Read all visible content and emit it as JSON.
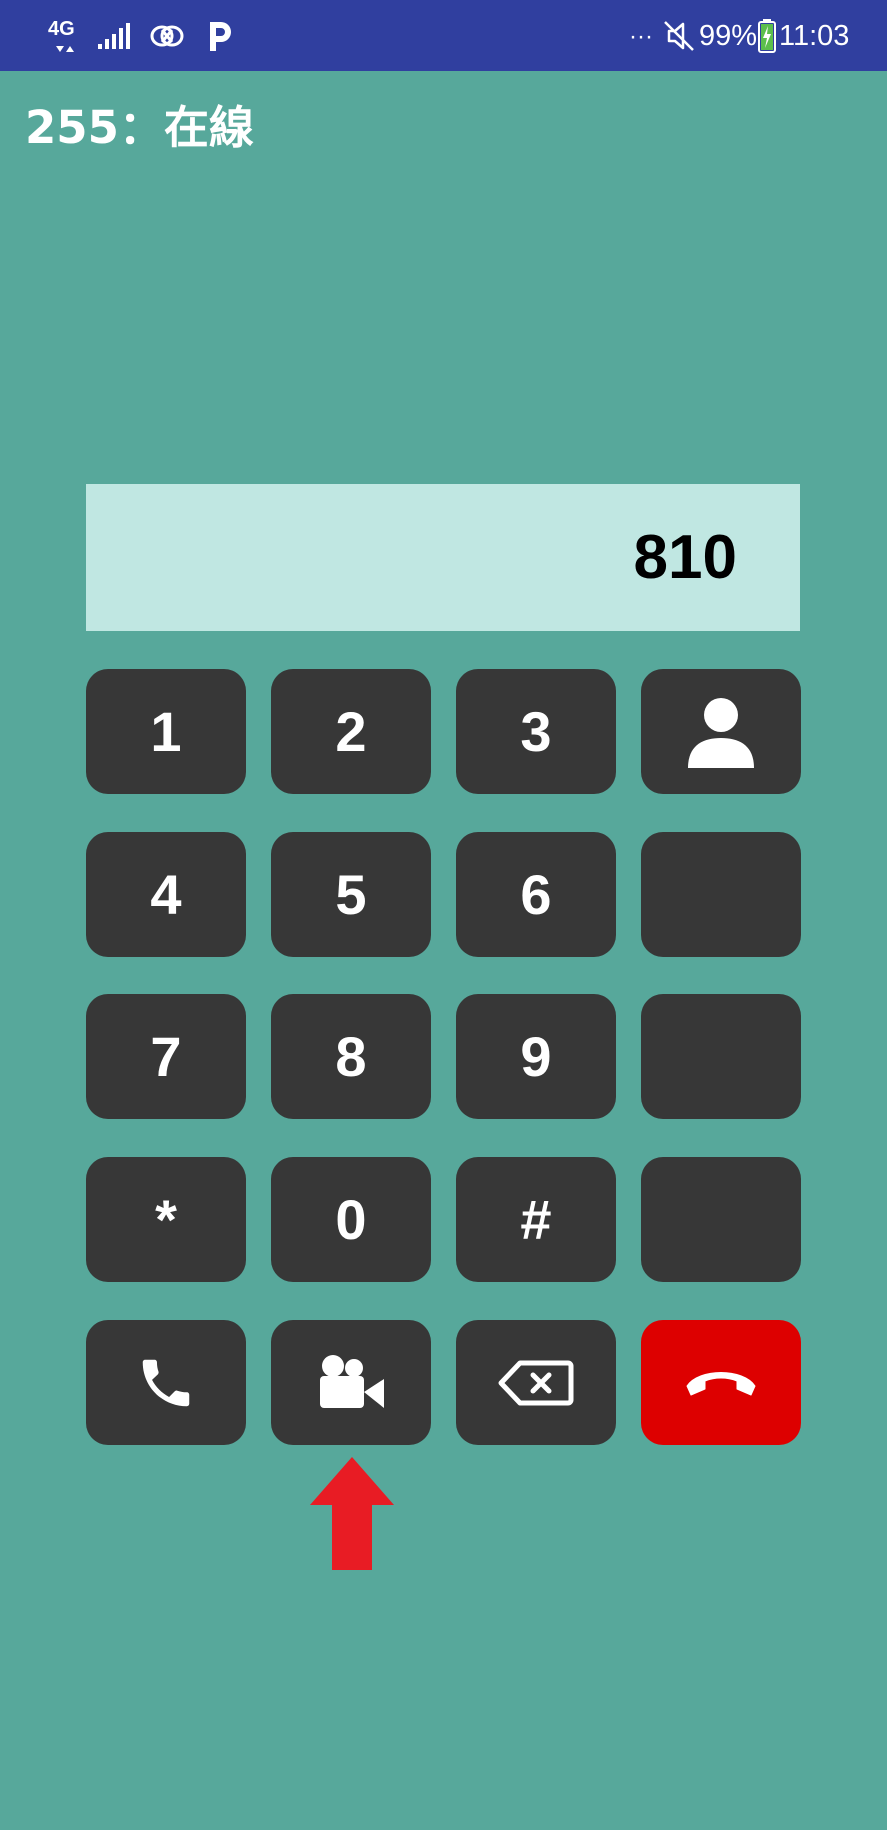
{
  "status_bar": {
    "network_type": "4G",
    "battery": "99%",
    "time": "11:03",
    "overflow": "···",
    "icons": [
      "network-4g-icon",
      "signal-strength-icon",
      "sync-icon",
      "parking-app-icon",
      "mute-icon",
      "battery-charging-icon"
    ]
  },
  "app": {
    "title": "255：在線"
  },
  "dialer": {
    "display_value": "810",
    "keys_row1": [
      "1",
      "2",
      "3"
    ],
    "keys_row2": [
      "4",
      "5",
      "6"
    ],
    "keys_row3": [
      "7",
      "8",
      "9"
    ],
    "keys_row4": [
      "*",
      "0",
      "#"
    ],
    "icons": {
      "contact": "person-icon",
      "call": "phone-icon",
      "video": "video-camera-icon",
      "backspace": "backspace-icon",
      "hangup": "hang-up-icon"
    }
  },
  "colors": {
    "background": "#57a89b",
    "status_bar": "#303f9f",
    "display_bg": "#c0e7e2",
    "key_bg": "#373737",
    "hangup_bg": "#dd0000",
    "annotation_arrow": "#e81c24"
  }
}
